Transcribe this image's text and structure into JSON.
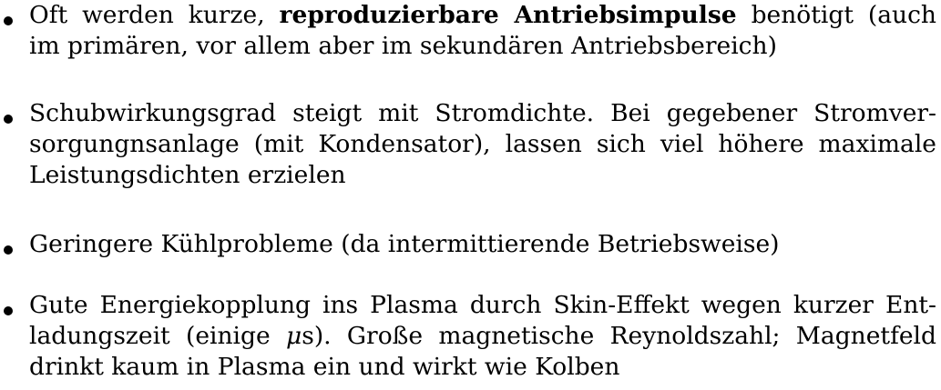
{
  "bullets": [
    {
      "lines": [
        {
          "before": "Oft werden kurze, ",
          "bold": "reproduzierbare Antriebsimpulse",
          "after": " benötigt (auch"
        },
        {
          "text": "im primären, vor allem aber im sekundären Antriebsbereich)"
        }
      ]
    },
    {
      "lines": [
        {
          "text": "Schubwirkungsgrad steigt mit Stromdichte. Bei gegebener Stromver-"
        },
        {
          "text": "sorgungnsanlage (mit Kondensator), lassen sich viel höhere maximale"
        },
        {
          "text": "Leistungsdichten erzielen"
        }
      ]
    },
    {
      "lines": [
        {
          "text": "Geringere Kühlprobleme (da intermittierende Betriebsweise)"
        }
      ]
    },
    {
      "lines": [
        {
          "text": "Gute Energiekopplung ins Plasma durch Skin-Effekt wegen kurzer Ent-"
        },
        {
          "before": "ladungszeit (einige ",
          "mu": "μ",
          "after": "s). Große magnetische Reynoldszahl; Magnetfeld"
        },
        {
          "text": "drinkt kaum in Plasma ein und wirkt wie Kolben"
        }
      ]
    }
  ]
}
